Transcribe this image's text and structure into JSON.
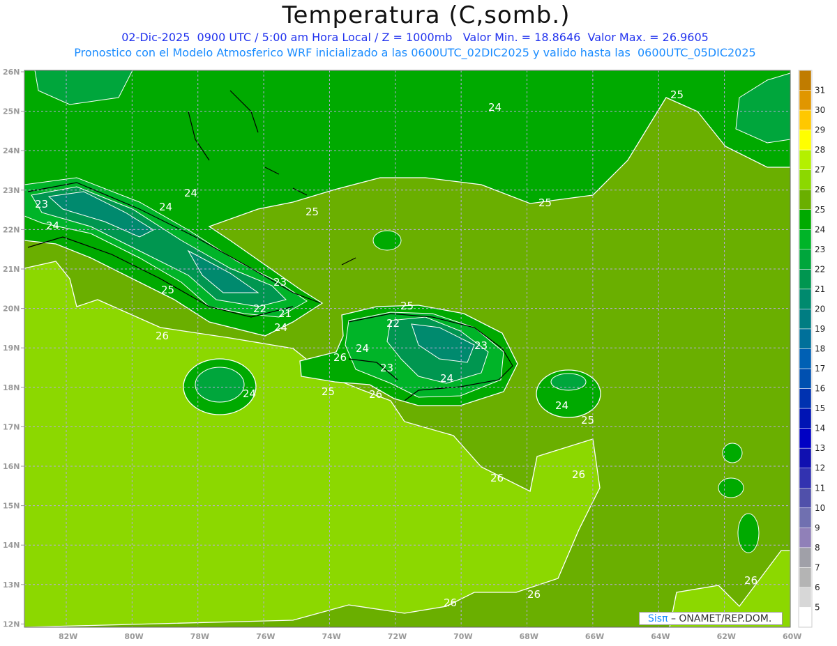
{
  "header": {
    "title": "Temperatura (C,somb.)",
    "subtitle": "02-Dic-2025  0900 UTC / 5:00 am Hora Local / Z = 1000mb   Valor Min. = 18.8646  Valor Max. = 26.9605",
    "model_info": "Pronostico con el Modelo Atmosferico WRF inicializado a las 0600UTC_02DIC2025 y valido hasta las  0600UTC_05DIC2025"
  },
  "axes": {
    "lat_labels": [
      "26N",
      "25N",
      "24N",
      "23N",
      "22N",
      "21N",
      "20N",
      "19N",
      "18N",
      "17N",
      "16N",
      "15N",
      "14N",
      "13N",
      "12N"
    ],
    "lon_labels": [
      "82W",
      "80W",
      "78W",
      "76W",
      "74W",
      "72W",
      "70W",
      "68W",
      "66W",
      "64W",
      "62W",
      "60W"
    ]
  },
  "colorbar": {
    "labels": [
      "31",
      "30",
      "29",
      "28",
      "27",
      "26",
      "25",
      "24",
      "23",
      "22",
      "21",
      "20",
      "19",
      "18",
      "17",
      "16",
      "15",
      "14",
      "13",
      "12",
      "11",
      "10",
      "9",
      "8",
      "7",
      "6",
      "5"
    ],
    "colors": [
      "#c07c00",
      "#e09600",
      "#ffc800",
      "#ffff00",
      "#b4f000",
      "#8cd800",
      "#6aaf00",
      "#00aa00",
      "#00b428",
      "#00a63c",
      "#009650",
      "#008a6e",
      "#007d82",
      "#00709a",
      "#0060b4",
      "#0050b0",
      "#0032b0",
      "#0014b4",
      "#0000c4",
      "#1010b0",
      "#3232b0",
      "#5050aa",
      "#7070b0",
      "#9080b8",
      "#a0a0a8",
      "#b4b4b4",
      "#d7d7d7",
      "#ffffff"
    ]
  },
  "contour_labels": [
    "24",
    "25",
    "24",
    "24",
    "23",
    "24",
    "25",
    "25",
    "25",
    "23",
    "22",
    "21",
    "24",
    "26",
    "25",
    "22",
    "24",
    "26",
    "23",
    "23",
    "24",
    "25",
    "26",
    "24",
    "24",
    "25",
    "26",
    "26",
    "26",
    "26",
    "26"
  ],
  "credit": {
    "brand": "Sisπ",
    "text": " – ONAMET/REP.DOM."
  }
}
